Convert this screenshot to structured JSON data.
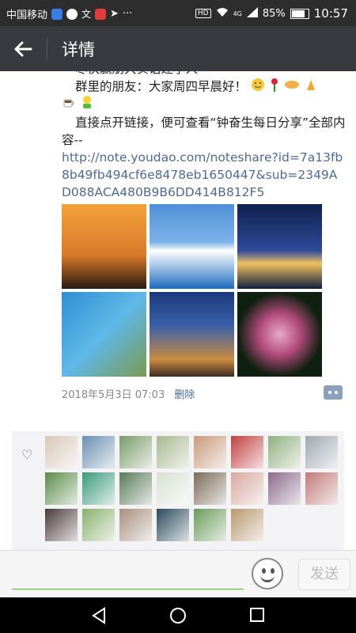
{
  "status_bar": {
    "carrier": "中国移动",
    "hd": "HD",
    "signal": "4G",
    "battery": "85%",
    "time": "10:57"
  },
  "header": {
    "title": "详情"
  },
  "post": {
    "cut_line": "尽快赢朋大实语建学人",
    "greeting": "群里的朋友：大家周四早晨好！",
    "instruction": "直接点开链接，便可查看“钟奋生每日分享”全部内容--",
    "link": "http://note.youdao.com/noteshare?id=7a13fb8b49fb494cf6e8478eb1650447&sub=2349AD088ACA480B9B6DD414B812F5",
    "photos": [
      {
        "name": "crane-sunset",
        "bg": "linear-gradient(#f2a23a,#d87a2a 60%,#2a1a10)"
      },
      {
        "name": "snow-mountain",
        "bg": "linear-gradient(#4e8fd8,#7fb3ea 45%,#ffffff 55%,#1e6bbf)"
      },
      {
        "name": "city-night",
        "bg": "linear-gradient(#10204d,#2e4b9a 55%,#f0c060 70%,#102040)"
      },
      {
        "name": "coast-bay",
        "bg": "linear-gradient(135deg,#2f8fd0,#5fb8e8 50%,#7a9a50)"
      },
      {
        "name": "street-dusk",
        "bg": "linear-gradient(#1c3a7a,#3a5fa8 40%,#c98a40 80%,#3a2a20)"
      },
      {
        "name": "lily-flowers",
        "bg": "radial-gradient(circle at 50% 50%,#e8a8c8,#b04a7a 35%,#102010 70%)"
      }
    ],
    "timestamp": "2018年5月3日 07:03",
    "delete_label": "删除"
  },
  "likes": {
    "avatars": [
      "#d8c8b8",
      "#6a8fb0",
      "#7a9a6a",
      "#a8b890",
      "#c89a7a",
      "#c04040",
      "#90b080",
      "#a0a8b0",
      "#5a8a4a",
      "#3a9a7a",
      "#5a7a5a",
      "#d8e0d0",
      "#7a6a5a",
      "#d8a8a0",
      "#8a6a8a",
      "#c07a7a",
      "#4a3a3a",
      "#8ab070",
      "#a89080",
      "#2a4a5a",
      "#6a9a5a",
      "#b89870"
    ]
  },
  "input_bar": {
    "send_label": "发送"
  },
  "colors": {
    "accent_green": "#45c01a",
    "link_blue": "#506a91",
    "appbar": "#393a3f"
  }
}
